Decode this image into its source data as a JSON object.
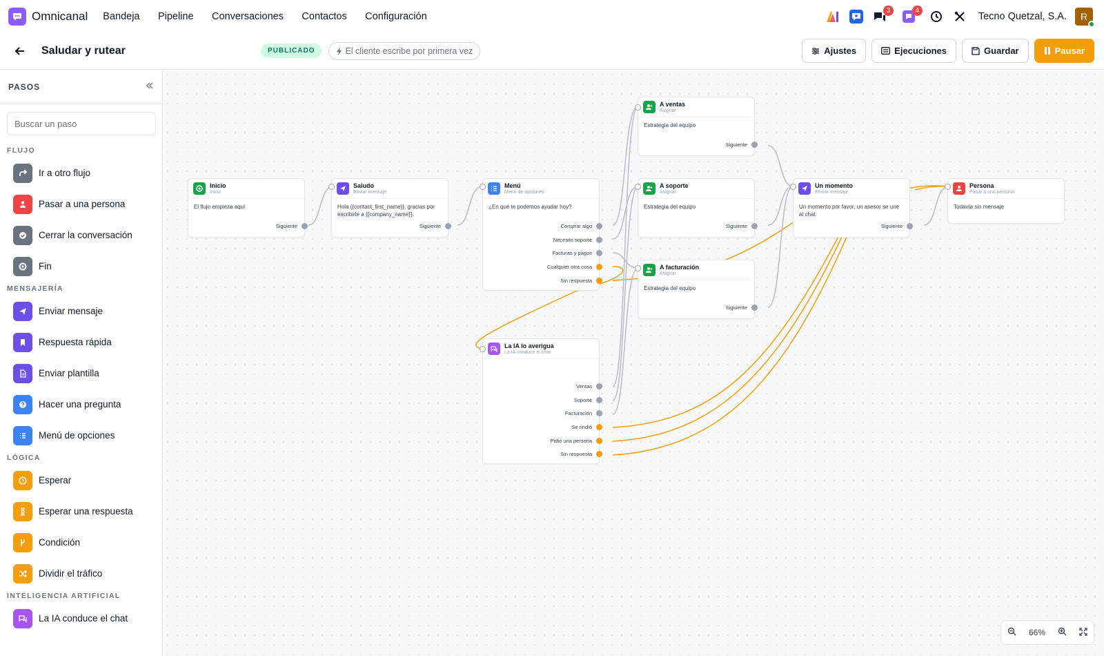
{
  "app": {
    "name": "Omnicanal"
  },
  "nav": [
    {
      "label": "Bandeja"
    },
    {
      "label": "Pipeline"
    },
    {
      "label": "Conversaciones"
    },
    {
      "label": "Contactos"
    },
    {
      "label": "Configuración"
    }
  ],
  "header": {
    "chat_badge": "3",
    "notif_badge": "4",
    "company": "Tecno Quetzal, S.A.",
    "avatar_letter": "R"
  },
  "flow": {
    "title": "Saludar y rutear",
    "status": "PUBLICADO",
    "trigger": "El cliente escribe por primera vez"
  },
  "actions": {
    "settings": "Ajustes",
    "runs": "Ejecuciones",
    "save": "Guardar",
    "pause": "Pausar"
  },
  "sidebar": {
    "title": "PASOS",
    "search_placeholder": "Buscar un paso",
    "sections": [
      {
        "title": "FLUJO",
        "items": [
          {
            "label": "Ir a otro flujo",
            "icon": "redirect-icon",
            "color": "#6b7280"
          },
          {
            "label": "Pasar a una persona",
            "icon": "person-icon",
            "color": "#ef4444"
          },
          {
            "label": "Cerrar la conversación",
            "icon": "check-circle-icon",
            "color": "#6b7280"
          },
          {
            "label": "Fin",
            "icon": "stop-icon",
            "color": "#6b7280"
          }
        ]
      },
      {
        "title": "MENSAJERÍA",
        "items": [
          {
            "label": "Enviar mensaje",
            "icon": "send-icon",
            "color": "#6d4ee6"
          },
          {
            "label": "Respuesta rápida",
            "icon": "bookmark-icon",
            "color": "#6d4ee6"
          },
          {
            "label": "Enviar plantilla",
            "icon": "document-icon",
            "color": "#6d4ee6"
          },
          {
            "label": "Hacer una pregunta",
            "icon": "question-icon",
            "color": "#3b82f6"
          },
          {
            "label": "Menú de opciones",
            "icon": "list-icon",
            "color": "#3b82f6"
          }
        ]
      },
      {
        "title": "LÓGICA",
        "items": [
          {
            "label": "Esperar",
            "icon": "clock-icon",
            "color": "#f59e0b"
          },
          {
            "label": "Esperar una respuesta",
            "icon": "hourglass-icon",
            "color": "#f59e0b"
          },
          {
            "label": "Condición",
            "icon": "branch-icon",
            "color": "#f59e0b"
          },
          {
            "label": "Dividir el tráfico",
            "icon": "shuffle-icon",
            "color": "#f59e0b"
          }
        ]
      },
      {
        "title": "INTELIGENCIA ARTIFICIAL",
        "items": [
          {
            "label": "La IA conduce el chat",
            "icon": "ai-chat-icon",
            "color": "#a855f7"
          }
        ]
      }
    ]
  },
  "nodes": {
    "inicio": {
      "title": "Inicio",
      "subtitle": "Inicio",
      "body": "El flujo empieza aquí",
      "outs": [
        "Siguiente"
      ]
    },
    "saludo": {
      "title": "Saludo",
      "subtitle": "Enviar mensaje",
      "body": "Hola {{contact_first_name}}, gracias por escribirle a {{company_name}}.",
      "outs": [
        "Siguiente"
      ]
    },
    "menu": {
      "title": "Menú",
      "subtitle": "Menú de opciones",
      "body": "¿En qué te podemos ayudar hoy?",
      "outs": [
        "Comprar algo",
        "Necesito soporte",
        "Facturas y pagos",
        "Cualquier otra cosa",
        "Sin respuesta"
      ]
    },
    "ventas": {
      "title": "A ventas",
      "subtitle": "Asignar",
      "body": "Estrategia del equipo",
      "outs": [
        "Siguiente"
      ]
    },
    "soporte": {
      "title": "A soporte",
      "subtitle": "Asignar",
      "body": "Estrategia del equipo",
      "outs": [
        "Siguiente"
      ]
    },
    "facturacion": {
      "title": "A facturación",
      "subtitle": "Asignar",
      "body": "Estrategia del equipo",
      "outs": [
        "Siguiente"
      ]
    },
    "momento": {
      "title": "Un momento",
      "subtitle": "Enviar mensaje",
      "body": "Un momento por favor, un asesor se une al chat.",
      "outs": [
        "Siguiente"
      ]
    },
    "persona": {
      "title": "Persona",
      "subtitle": "Pasar a una persona",
      "body": "Todavía sin mensaje",
      "outs": []
    },
    "ia": {
      "title": "La IA lo averigua",
      "subtitle": "La IA conduce el chat",
      "body": "",
      "outs": [
        "Ventas",
        "Soporte",
        "Facturación",
        "Se rindió",
        "Pidió una persona",
        "Sin respuesta"
      ]
    }
  },
  "zoom": {
    "level": "66%"
  },
  "colors": {
    "accent": "#f59e0b",
    "brand": "#8b5cf6",
    "edge": "#b7bcc8",
    "edge_fallback": "#f59e0b"
  }
}
